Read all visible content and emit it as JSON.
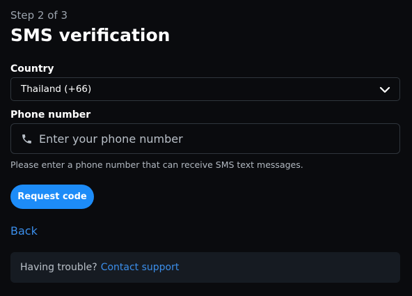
{
  "header": {
    "step": "Step 2 of 3",
    "title": "SMS verification"
  },
  "country": {
    "label": "Country",
    "selected": "Thailand (+66)",
    "icon": "chevron-down-icon"
  },
  "phone": {
    "label": "Phone number",
    "value": "",
    "placeholder": "Enter your phone number",
    "icon": "phone-icon",
    "hint": "Please enter a phone number that can receive SMS text messages."
  },
  "actions": {
    "request_label": "Request code",
    "back_label": "Back"
  },
  "support": {
    "text": "Having trouble?",
    "link_label": "Contact support"
  },
  "colors": {
    "background": "#0a0b0e",
    "accent": "#1d8cf8",
    "link": "#3b8eea",
    "panel": "#161b22",
    "border": "#30363d"
  }
}
